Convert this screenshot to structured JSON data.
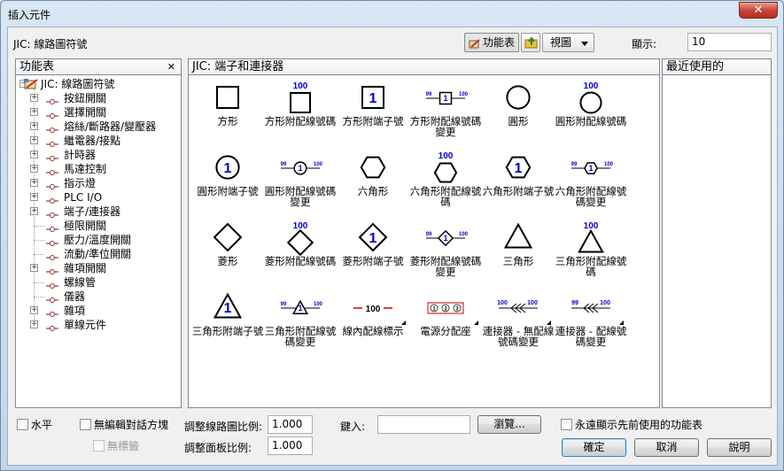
{
  "window": {
    "title": "插入元件",
    "close_glyph": "✕"
  },
  "header": {
    "library": "JIC: 線路圖符號",
    "menu_button": "功能表",
    "view_button": "視圖",
    "display_label": "顯示:",
    "display_value": "10"
  },
  "left_panel": {
    "title": "功能表",
    "close_glyph": "✕",
    "root": {
      "expander": "−",
      "label": "JIC: 線路圖符號"
    },
    "items": [
      {
        "label": "按鈕開關",
        "expander": "+"
      },
      {
        "label": "選擇開關",
        "expander": "+"
      },
      {
        "label": "熔絲/斷路器/變壓器",
        "expander": "+"
      },
      {
        "label": "繼電器/接點",
        "expander": "+"
      },
      {
        "label": "計時器",
        "expander": "+"
      },
      {
        "label": "馬達控制",
        "expander": "+"
      },
      {
        "label": "指示燈",
        "expander": "+"
      },
      {
        "label": "PLC I/O",
        "expander": "+"
      },
      {
        "label": "端子/連接器",
        "expander": "+"
      },
      {
        "label": "極限開關",
        "expander": ""
      },
      {
        "label": "壓力/溫度開關",
        "expander": ""
      },
      {
        "label": "流動/準位開關",
        "expander": ""
      },
      {
        "label": "雜項開關",
        "expander": "+"
      },
      {
        "label": "螺線管",
        "expander": ""
      },
      {
        "label": "儀器",
        "expander": ""
      },
      {
        "label": "雜項",
        "expander": "+"
      },
      {
        "label": "單線元件",
        "expander": "+"
      }
    ]
  },
  "center_panel": {
    "title": "JIC: 端子和連接器",
    "symbols": [
      {
        "label": "方形",
        "shape": "square",
        "top": "",
        "inner": "",
        "inline": false
      },
      {
        "label": "方形附配線號碼",
        "shape": "square",
        "top": "100",
        "inner": "",
        "inline": false
      },
      {
        "label": "方形附端子號",
        "shape": "square",
        "top": "",
        "inner": "1",
        "inline": false
      },
      {
        "label": "方形附配線號碼變更",
        "shape": "square",
        "top": "",
        "inner": "1",
        "inline": true,
        "left": "99",
        "right": "100"
      },
      {
        "label": "圓形",
        "shape": "circle",
        "top": "",
        "inner": "",
        "inline": false
      },
      {
        "label": "圓形附配線號碼",
        "shape": "circle",
        "top": "100",
        "inner": "",
        "inline": false
      },
      {
        "label": "圓形附端子號",
        "shape": "circle",
        "top": "",
        "inner": "1",
        "inline": false
      },
      {
        "label": "圓形附配線號碼變更",
        "shape": "circle",
        "top": "",
        "inner": "1",
        "inline": true,
        "left": "99",
        "right": "100"
      },
      {
        "label": "六角形",
        "shape": "hexagon",
        "top": "",
        "inner": "",
        "inline": false
      },
      {
        "label": "六角形附配線號碼",
        "shape": "hexagon",
        "top": "100",
        "inner": "",
        "inline": false
      },
      {
        "label": "六角形附端子號",
        "shape": "hexagon",
        "top": "",
        "inner": "1",
        "inline": false
      },
      {
        "label": "六角形附配線號碼變更",
        "shape": "hexagon",
        "top": "",
        "inner": "1",
        "inline": true,
        "left": "99",
        "right": "100"
      },
      {
        "label": "菱形",
        "shape": "diamond",
        "top": "",
        "inner": "",
        "inline": false
      },
      {
        "label": "菱形附配線號碼",
        "shape": "diamond",
        "top": "100",
        "inner": "",
        "inline": false
      },
      {
        "label": "菱形附端子號",
        "shape": "diamond",
        "top": "",
        "inner": "1",
        "inline": false
      },
      {
        "label": "菱形附配線號碼變更",
        "shape": "diamond",
        "top": "",
        "inner": "1",
        "inline": true,
        "left": "99",
        "right": "100"
      },
      {
        "label": "三角形",
        "shape": "triangle",
        "top": "",
        "inner": "",
        "inline": false
      },
      {
        "label": "三角形附配線號碼",
        "shape": "triangle",
        "top": "100",
        "inner": "",
        "inline": false
      },
      {
        "label": "三角形附端子號",
        "shape": "triangle",
        "top": "",
        "inner": "1",
        "inline": false
      },
      {
        "label": "三角形附配線號碼變更",
        "shape": "triangle",
        "top": "",
        "inner": "1",
        "inline": true,
        "left": "99",
        "right": "100"
      },
      {
        "label": "線內配線標示",
        "shape": "inline-marker",
        "top": "",
        "inner": "100",
        "inline": true,
        "more": true
      },
      {
        "label": "電源分配座",
        "shape": "power-block",
        "top": "",
        "inner": "",
        "inline": false,
        "terminals": [
          "1",
          "2",
          "3"
        ],
        "more": true
      },
      {
        "label": "連接器 - 無配線號碼變更",
        "shape": "connector",
        "top": "",
        "inner": "",
        "inline": true,
        "left": "100",
        "right": "100",
        "more": true
      },
      {
        "label": "連接器 - 配線號碼變更",
        "shape": "connector",
        "top": "",
        "inner": "",
        "inline": true,
        "left": "99",
        "right": "100",
        "more": true
      }
    ]
  },
  "right_panel": {
    "title": "最近使用的"
  },
  "bottom": {
    "horizontal": "水平",
    "no_edit_dialog": "無編輯對話方塊",
    "no_tag": "無標籤",
    "schematic_scale_label": "調整線路圖比例:",
    "schematic_scale_value": "1.000",
    "panel_scale_label": "調整面板比例:",
    "panel_scale_value": "1.000",
    "type_label": "鍵入:",
    "type_value": "",
    "browse_button": "瀏覽...",
    "always_show_previous": "永遠顯示先前使用的功能表",
    "ok_button": "確定",
    "cancel_button": "取消",
    "help_button": "說明"
  },
  "colors": {
    "accent_blue": "#0000cc",
    "power_red": "#cc0000"
  }
}
